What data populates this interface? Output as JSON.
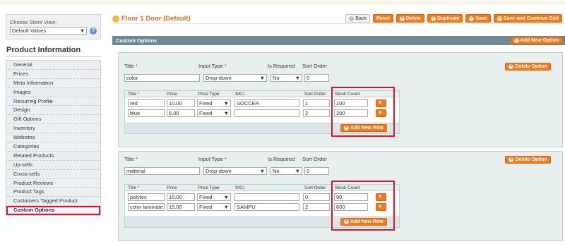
{
  "store": {
    "label": "Choose Store View:",
    "selected": "Default Values",
    "help_icon": "help-icon"
  },
  "sidebar": {
    "title": "Product Information",
    "items": [
      "General",
      "Prices",
      "Meta Information",
      "Images",
      "Recurring Profile",
      "Design",
      "Gift Options",
      "Inventory",
      "Websites",
      "Categories",
      "Related Products",
      "Up-sells",
      "Cross-sells",
      "Product Reviews",
      "Product Tags",
      "Customers Tagged Product",
      "Custom Options"
    ],
    "active": "Custom Options"
  },
  "header": {
    "title": "Floor 1 Door (Default)",
    "buttons": {
      "back": "Back",
      "reset": "Reset",
      "delete": "Delete",
      "duplicate": "Duplicate",
      "save": "Save",
      "save_continue": "Save and Continue Edit"
    }
  },
  "custom_options": {
    "header": "Custom Options",
    "add_new_option": "Add New Option",
    "labels": {
      "title": "Title",
      "input_type": "Input Type",
      "is_required": "Is Required",
      "sort_order": "Sort Order",
      "delete_option": "Delete Option",
      "row_title": "Title",
      "price": "Price",
      "price_type": "Price Type",
      "sku": "SKU",
      "row_sort_order": "Sort Order",
      "stock_count": "Stock Count",
      "add_new_row": "Add New Row",
      "required_mark": "*"
    },
    "options": [
      {
        "title": "color",
        "input_type": "Drop-down",
        "is_required": "No",
        "sort_order": "0",
        "rows": [
          {
            "title": "red",
            "price": "10.00",
            "price_type": "Fixed",
            "sku": "SOCCER",
            "sort_order": "1",
            "stock": "100"
          },
          {
            "title": "blue",
            "price": "5.00",
            "price_type": "Fixed",
            "sku": "",
            "sort_order": "2",
            "stock": "200"
          }
        ]
      },
      {
        "title": "material",
        "input_type": "Drop-down",
        "is_required": "No",
        "sort_order": "0",
        "rows": [
          {
            "title": "polytec",
            "price": "10.00",
            "price_type": "Fixed",
            "sku": "",
            "sort_order": "0",
            "stock": "90"
          },
          {
            "title": "color laminate",
            "price": "15.00",
            "price_type": "Fixed",
            "sku": "SAMPU",
            "sort_order": "2",
            "stock": "600"
          }
        ]
      }
    ]
  },
  "colors": {
    "accent": "#f17a1c",
    "title": "#e06f16",
    "header_bar": "#6f8992",
    "highlight": "#e2122c"
  }
}
